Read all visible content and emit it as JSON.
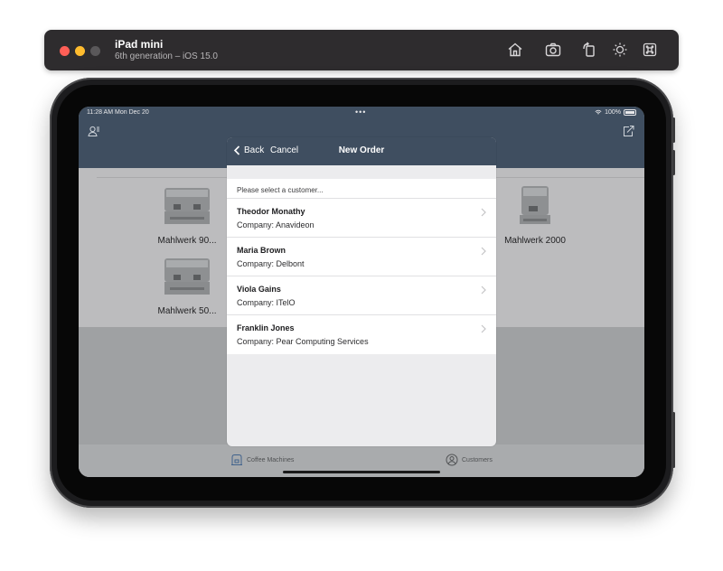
{
  "simulator": {
    "device_name": "iPad mini",
    "device_detail": "6th generation – iOS 15.0",
    "tools": [
      "home-icon",
      "screenshot-icon",
      "rotate-icon",
      "brightness-icon",
      "command-icon"
    ]
  },
  "status_bar": {
    "time": "11:28 AM  Mon Dec 20",
    "dots": "•••",
    "battery": "100%"
  },
  "background": {
    "machines": [
      {
        "name": "Mahlwerk 90..."
      },
      {
        "name": "Mahlwerk 50..."
      },
      {
        "name": "Mahlwerk 2000"
      }
    ],
    "tabs": [
      {
        "label": "Coffee Machines",
        "icon": "coffee-machine-icon"
      },
      {
        "label": "Customers",
        "icon": "person-circle-icon"
      }
    ]
  },
  "modal": {
    "back_label": "Back",
    "cancel_label": "Cancel",
    "title": "New Order",
    "hint": "Please select a customer...",
    "customers": [
      {
        "name": "Theodor Monathy",
        "company": "Company: Anavideon"
      },
      {
        "name": "Maria Brown",
        "company": "Company: Delbont"
      },
      {
        "name": "Viola Gains",
        "company": "Company: ITelO"
      },
      {
        "name": "Franklin Jones",
        "company": "Company: Pear Computing Services"
      }
    ]
  },
  "colors": {
    "nav_bar": "#3f4e60",
    "modal_bg": "#ececee"
  }
}
